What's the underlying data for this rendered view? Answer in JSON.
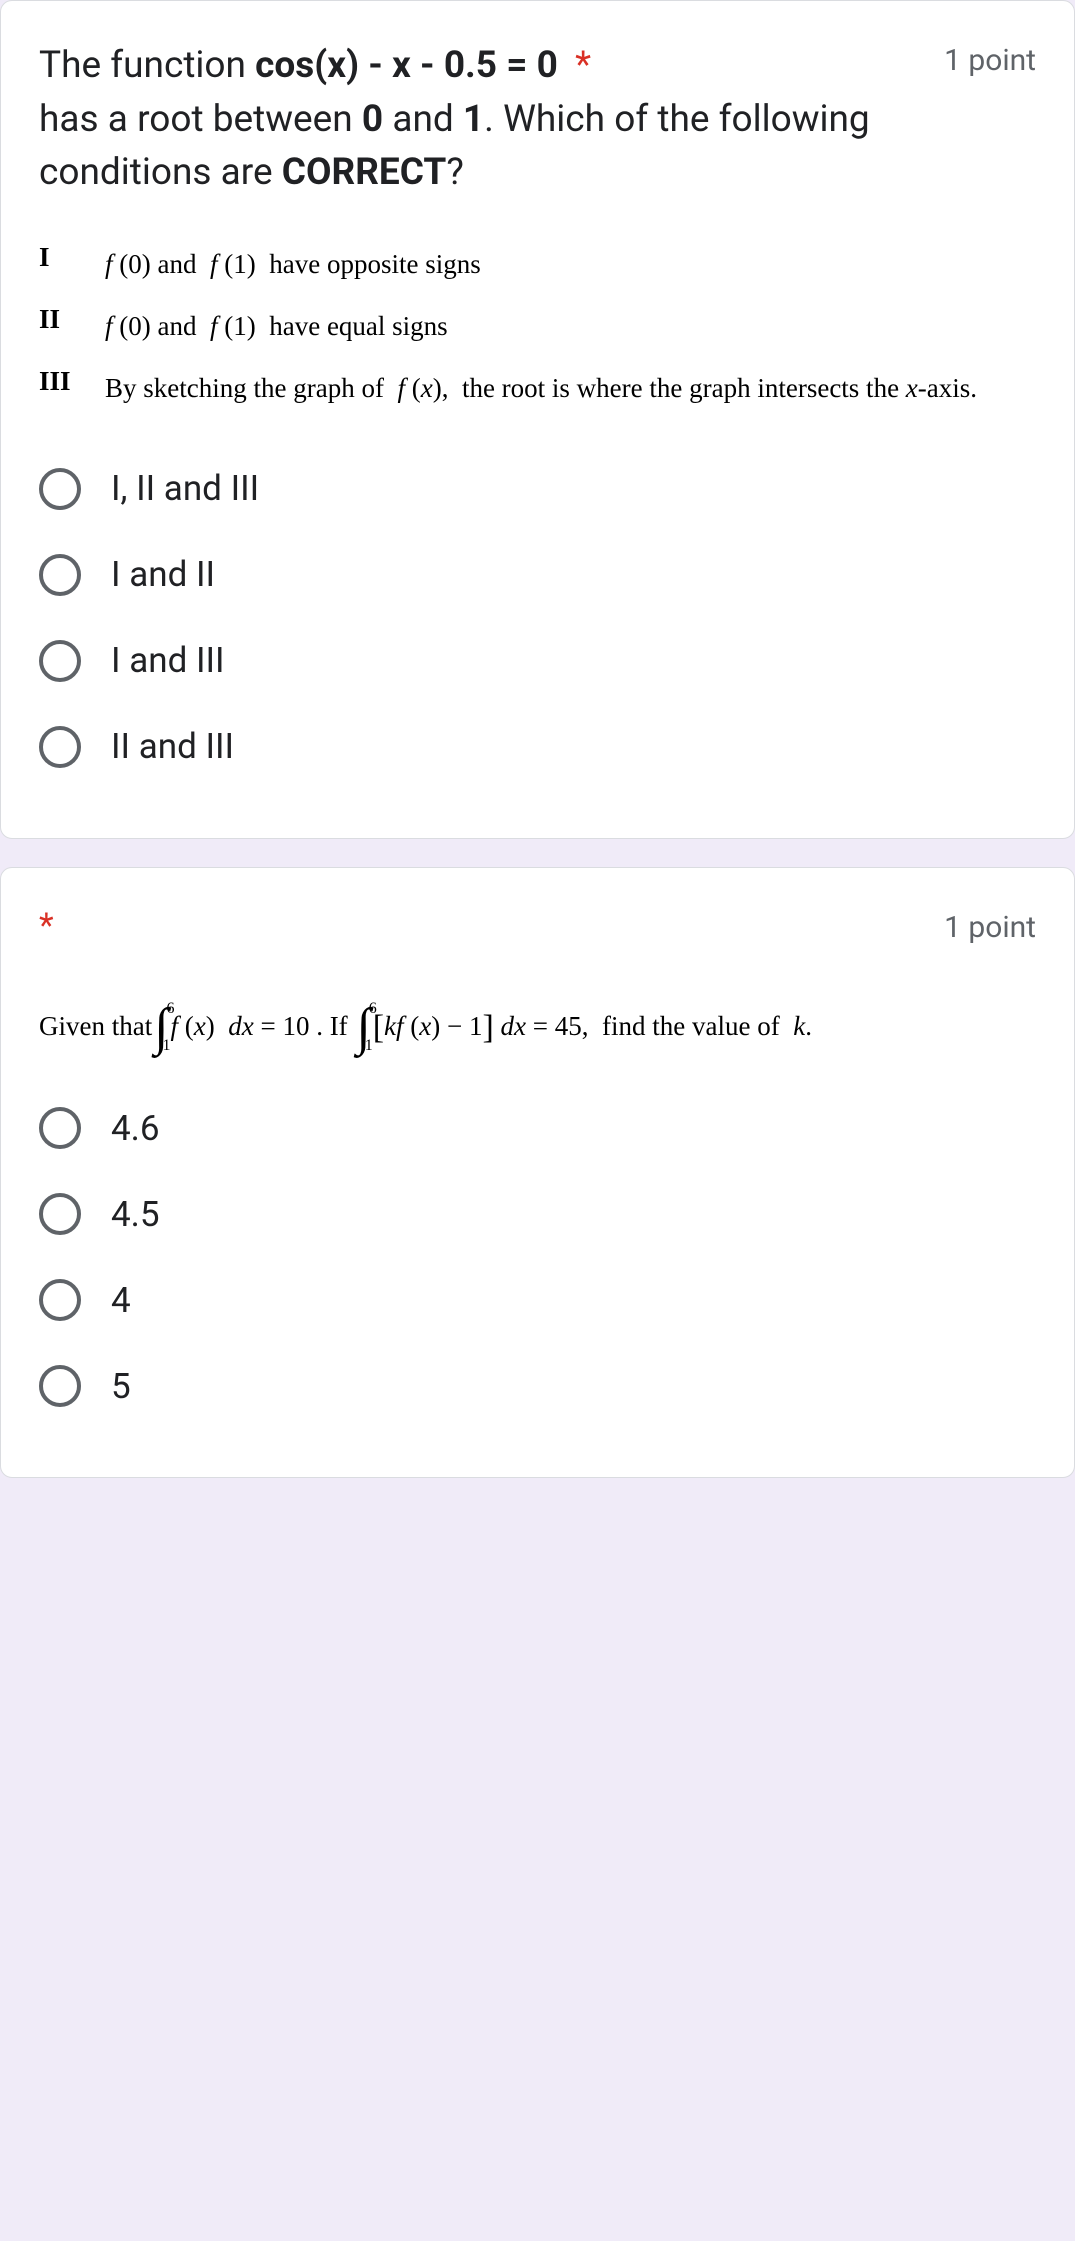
{
  "q1": {
    "title_pre": "The function ",
    "title_eq": "cos(x) - x - 0.5 = 0",
    "title_mid": " has a root between ",
    "title_bold0": "0",
    "title_and": " and ",
    "title_bold1": "1",
    "title_end": ". Which of the following conditions are ",
    "title_correct": "CORRECT",
    "title_q": "?",
    "asterisk": "*",
    "points": "1 point",
    "conditions": [
      {
        "num": "I",
        "text": "f (0) and  f (1)  have opposite signs"
      },
      {
        "num": "II",
        "text": "f (0) and  f (1)  have equal signs"
      },
      {
        "num": "III",
        "text": "By sketching the graph of  f (x),  the root is where the graph intersects the x-axis."
      }
    ],
    "options": [
      "I, II and III",
      "I and II",
      "I and III",
      "II and III"
    ]
  },
  "q2": {
    "asterisk": "*",
    "points": "1 point",
    "given_pre": "Given that ",
    "int1_top": "6",
    "int1_bot": "1",
    "int1_body": "f (x) dx = 10 . If ",
    "int2_top": "6",
    "int2_bot": "1",
    "int2_body_open": "[",
    "int2_body_k": "kf",
    "int2_body_mid": " (x) − 1",
    "int2_body_close": "]",
    "int2_body_rest": " dx = 45,  find the value of  k.",
    "options": [
      "4.6",
      "4.5",
      "4",
      "5"
    ]
  }
}
